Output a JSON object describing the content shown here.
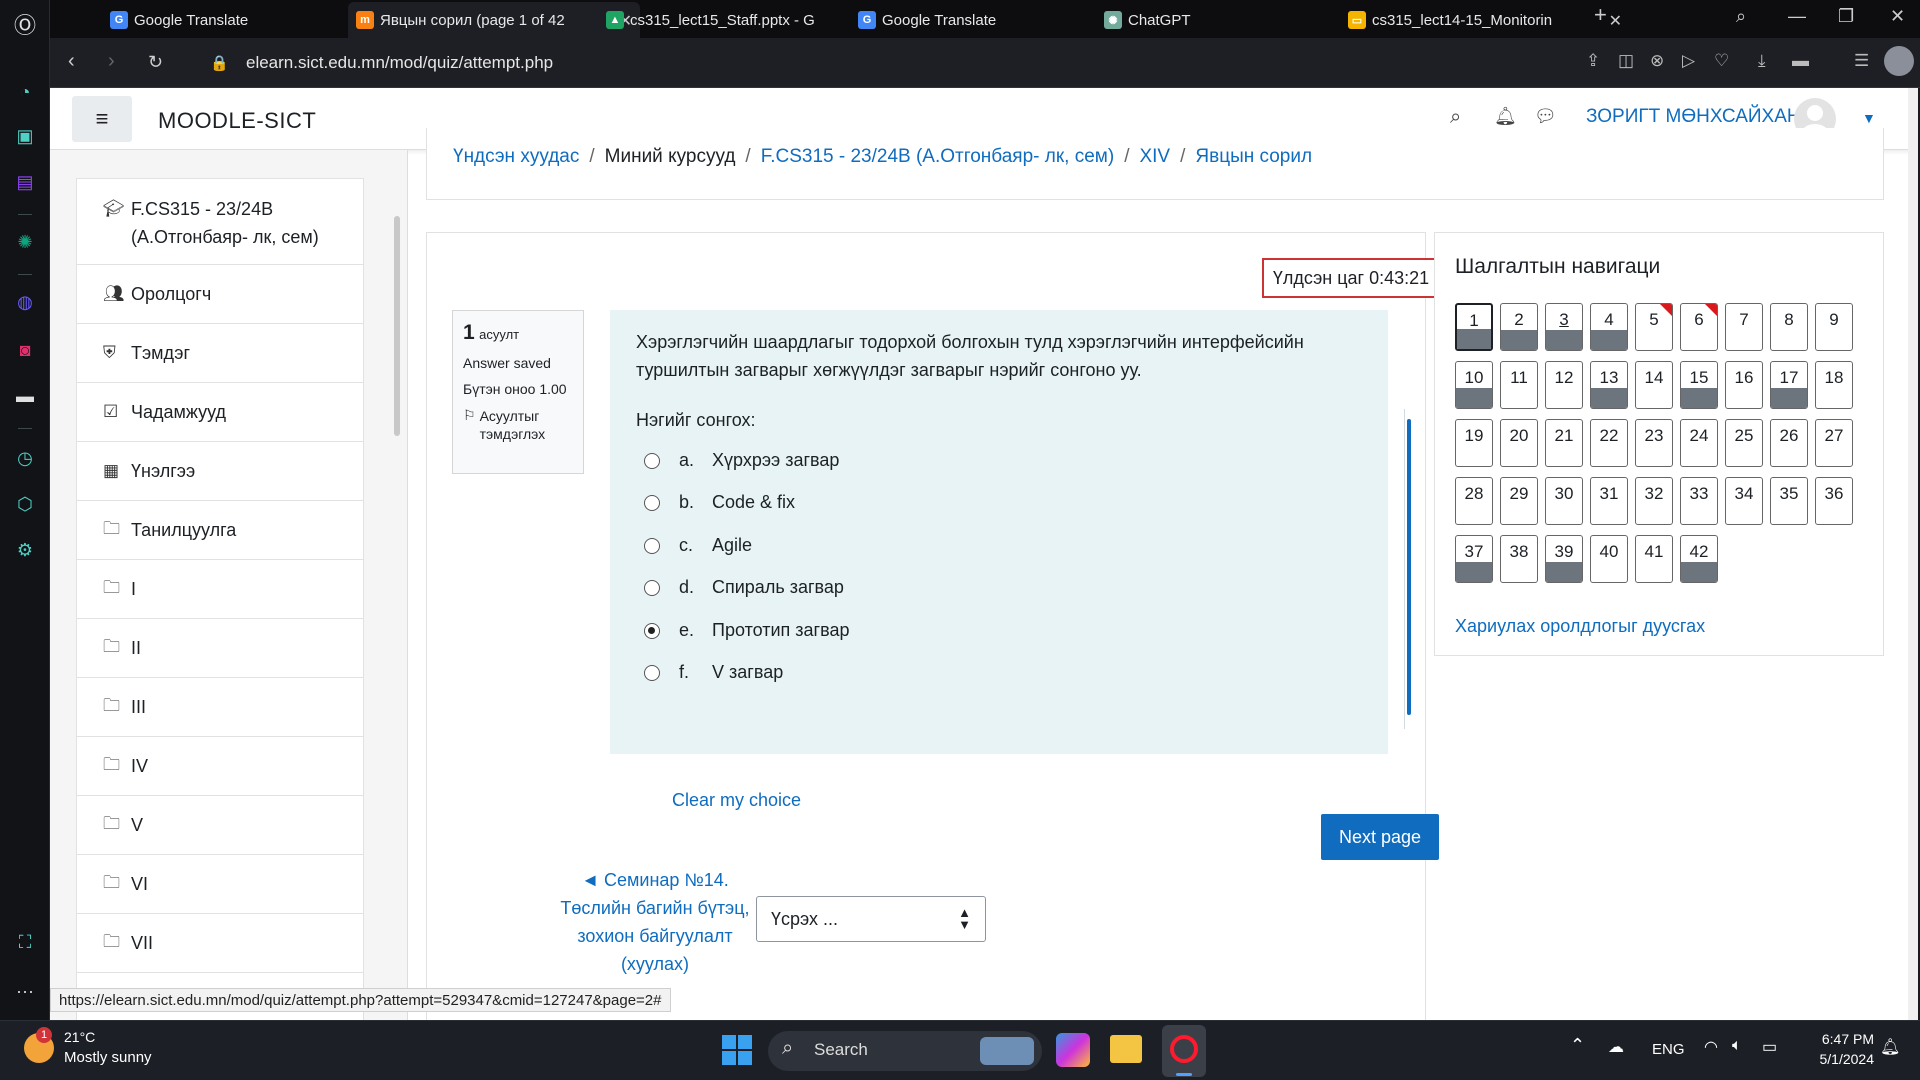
{
  "browser": {
    "tabs": [
      {
        "title": "Google Translate",
        "favicon": "translate-icon",
        "color": "#4285f4",
        "active": false
      },
      {
        "title": "Явцын сорил (page 1 of 42",
        "favicon": "moodle-icon",
        "color": "#f98012",
        "active": true
      },
      {
        "title": "cs315_lect15_Staff.pptx - G",
        "favicon": "drive-icon",
        "color": "#1fa463",
        "active": false
      },
      {
        "title": "Google Translate",
        "favicon": "translate-icon",
        "color": "#4285f4",
        "active": false
      },
      {
        "title": "ChatGPT",
        "favicon": "chatgpt-icon",
        "color": "#74aa9c",
        "active": false
      },
      {
        "title": "cs315_lect14-15_Monitorin",
        "favicon": "slides-icon",
        "color": "#f4b400",
        "active": false
      }
    ],
    "url": "elearn.sict.edu.mn/mod/quiz/attempt.php",
    "status_url": "https://elearn.sict.edu.mn/mod/quiz/attempt.php?attempt=529347&cmid=127247&page=2#"
  },
  "moodle": {
    "site_name": "MOODLE-SICT",
    "user_name": "ЗОРИГТ МӨНХСАЙХАН"
  },
  "drawer": {
    "items": [
      {
        "label": "F.CS315 - 23/24B (А.Отгонбаяр- лк, сем)",
        "icon": "graduation-cap-icon",
        "glyph": "🎓"
      },
      {
        "label": "Оролцогч",
        "icon": "users-icon",
        "glyph": "👥"
      },
      {
        "label": "Тэмдэг",
        "icon": "shield-icon",
        "glyph": "⛨"
      },
      {
        "label": "Чадамжууд",
        "icon": "checkbox-icon",
        "glyph": "☑"
      },
      {
        "label": "Үнэлгээ",
        "icon": "table-icon",
        "glyph": "▦"
      },
      {
        "label": "Танилцуулга",
        "icon": "folder-icon",
        "glyph": "🗀"
      },
      {
        "label": "I",
        "icon": "folder-icon",
        "glyph": "🗀"
      },
      {
        "label": "II",
        "icon": "folder-icon",
        "glyph": "🗀"
      },
      {
        "label": "III",
        "icon": "folder-icon",
        "glyph": "🗀"
      },
      {
        "label": "IV",
        "icon": "folder-icon",
        "glyph": "🗀"
      },
      {
        "label": "V",
        "icon": "folder-icon",
        "glyph": "🗀"
      },
      {
        "label": "VI",
        "icon": "folder-icon",
        "glyph": "🗀"
      },
      {
        "label": "VII",
        "icon": "folder-icon",
        "glyph": "🗀"
      }
    ]
  },
  "breadcrumb": {
    "home": "Үндсэн хуудас",
    "my_courses": "Миний курсууд",
    "course": "F.CS315 - 23/24B (А.Отгонбаяр- лк, сем)",
    "section": "XIV",
    "quiz": "Явцын сорил"
  },
  "timer": {
    "label": "Үлдсэн цаг",
    "value": "0:43:21"
  },
  "question": {
    "number": "1",
    "number_label": "асуулт",
    "state": "Answer saved",
    "mark": "Бүтэн оноо 1.00",
    "flag_label": "Асуултыг тэмдэглэх",
    "text": "Хэрэглэгчийн шаардлагыг тодорхой болгохын тулд хэрэглэгчийн интерфейсийн туршилтын загварыг хөгжүүлдэг загварыг нэрийг сонгоно уу.",
    "prompt": "Нэгийг сонгох:",
    "options": [
      {
        "letter": "a.",
        "text": "Хүрхрээ загвар",
        "selected": false
      },
      {
        "letter": "b.",
        "text": "Code & fix",
        "selected": false
      },
      {
        "letter": "c.",
        "text": "Agile",
        "selected": false
      },
      {
        "letter": "d.",
        "text": "Спираль загвар",
        "selected": false
      },
      {
        "letter": "e.",
        "text": "Прототип загвар",
        "selected": true
      },
      {
        "letter": "f.",
        "text": "V загвар",
        "selected": false
      }
    ],
    "clear_label": "Clear my choice"
  },
  "navigation": {
    "next_label": "Next page",
    "prev_activity": "◄ Семинар №14. Төслийн багийн бүтэц, зохион байгуулалт (хуулах)",
    "jump_placeholder": "Үсрэх ..."
  },
  "quiz_nav": {
    "title": "Шалгалтын навигаци",
    "finish_label": "Хариулах оролдлогыг дуусгах",
    "questions": [
      {
        "n": "1",
        "answered": true,
        "current": true,
        "flagged": false
      },
      {
        "n": "2",
        "answered": true,
        "current": false,
        "flagged": false
      },
      {
        "n": "3",
        "answered": true,
        "current": false,
        "flagged": false,
        "underline": true
      },
      {
        "n": "4",
        "answered": true,
        "current": false,
        "flagged": false
      },
      {
        "n": "5",
        "answered": false,
        "current": false,
        "flagged": true
      },
      {
        "n": "6",
        "answered": false,
        "current": false,
        "flagged": true
      },
      {
        "n": "7",
        "answered": false
      },
      {
        "n": "8",
        "answered": false
      },
      {
        "n": "9",
        "answered": false
      },
      {
        "n": "10",
        "answered": true
      },
      {
        "n": "11",
        "answered": false
      },
      {
        "n": "12",
        "answered": false
      },
      {
        "n": "13",
        "answered": true
      },
      {
        "n": "14",
        "answered": false
      },
      {
        "n": "15",
        "answered": true
      },
      {
        "n": "16",
        "answered": false
      },
      {
        "n": "17",
        "answered": true
      },
      {
        "n": "18",
        "answered": false
      },
      {
        "n": "19",
        "answered": false
      },
      {
        "n": "20",
        "answered": false
      },
      {
        "n": "21",
        "answered": false
      },
      {
        "n": "22",
        "answered": false
      },
      {
        "n": "23",
        "answered": false
      },
      {
        "n": "24",
        "answered": false
      },
      {
        "n": "25",
        "answered": false
      },
      {
        "n": "26",
        "answered": false
      },
      {
        "n": "27",
        "answered": false
      },
      {
        "n": "28",
        "answered": false
      },
      {
        "n": "29",
        "answered": false
      },
      {
        "n": "30",
        "answered": false
      },
      {
        "n": "31",
        "answered": false
      },
      {
        "n": "32",
        "answered": false
      },
      {
        "n": "33",
        "answered": false
      },
      {
        "n": "34",
        "answered": false
      },
      {
        "n": "35",
        "answered": false
      },
      {
        "n": "36",
        "answered": false
      },
      {
        "n": "37",
        "answered": true
      },
      {
        "n": "38",
        "answered": false
      },
      {
        "n": "39",
        "answered": true
      },
      {
        "n": "40",
        "answered": false
      },
      {
        "n": "41",
        "answered": false
      },
      {
        "n": "42",
        "answered": true
      }
    ]
  },
  "taskbar": {
    "weather_temp": "21°C",
    "weather_desc": "Mostly sunny",
    "weather_badge": "1",
    "search_label": "Search",
    "lang": "ENG",
    "time": "6:47 PM",
    "date": "5/1/2024"
  },
  "colors": {
    "accent": "#0f6cbf",
    "answered": "#6c757d",
    "flag": "#d9191b",
    "question_bg": "#e7f3f5"
  }
}
